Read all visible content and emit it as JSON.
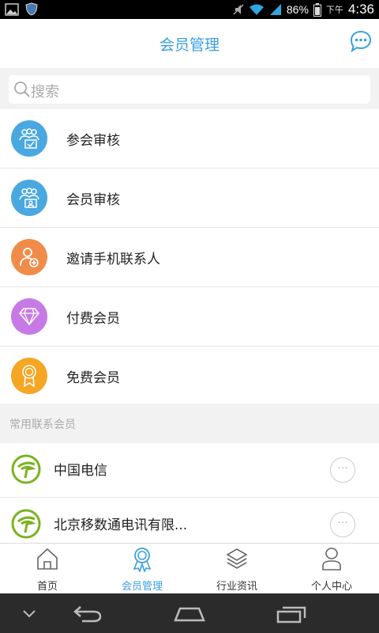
{
  "statusbar": {
    "battery": "86%",
    "ampm": "下午",
    "time": "4:36"
  },
  "header": {
    "title": "会员管理",
    "icon": "chat-bubble-icon"
  },
  "search": {
    "placeholder": "搜索"
  },
  "menu": [
    {
      "label": "参会审核",
      "color": "#4aa8e0",
      "icon": "group-review-icon"
    },
    {
      "label": "会员审核",
      "color": "#4aa8e0",
      "icon": "member-review-icon"
    },
    {
      "label": "邀请手机联系人",
      "color": "#f08c4a",
      "icon": "add-user-icon"
    },
    {
      "label": "付费会员",
      "color": "#c77ae6",
      "icon": "diamond-icon"
    },
    {
      "label": "免费会员",
      "color": "#f5a623",
      "icon": "award-icon"
    }
  ],
  "section": {
    "title": "常用联系会员"
  },
  "contacts": [
    {
      "name": "中国电信",
      "more": "···"
    },
    {
      "name": "北京移数通电讯有限...",
      "more": "···"
    }
  ],
  "tabs": [
    {
      "label": "首页",
      "icon": "home-icon"
    },
    {
      "label": "会员管理",
      "icon": "badge-icon",
      "active": true
    },
    {
      "label": "行业资讯",
      "icon": "layers-icon"
    },
    {
      "label": "个人中心",
      "icon": "person-icon"
    }
  ],
  "colors": {
    "accent": "#3a9fe0",
    "telecom_green": "#7ab31f"
  }
}
